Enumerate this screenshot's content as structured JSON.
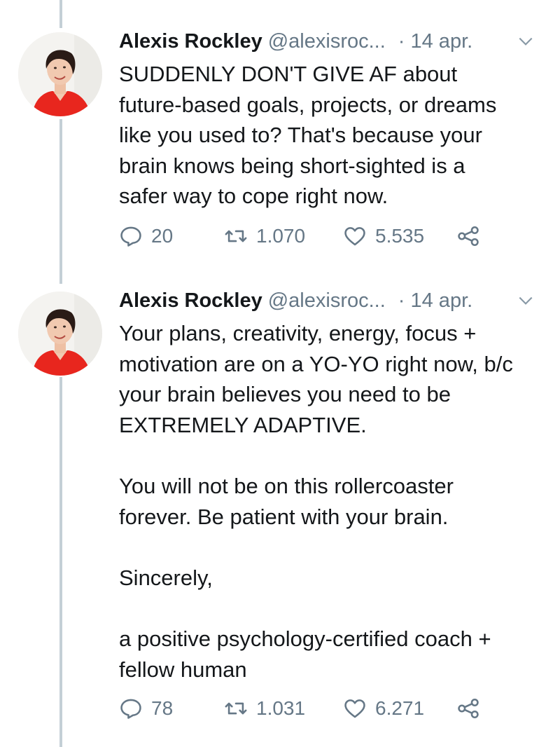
{
  "tweets": [
    {
      "author_name": "Alexis Rockley",
      "handle": "@alexisroc...",
      "date": "· 14 apr.",
      "text": "SUDDENLY DON'T GIVE AF about\nfuture-based goals, projects, or dreams\nlike you used to? That's because your\nbrain knows being short-sighted is a\nsafer way to cope right now.",
      "replies": "20",
      "retweets": "1.070",
      "likes": "5.535"
    },
    {
      "author_name": "Alexis Rockley",
      "handle": "@alexisroc...",
      "date": "· 14 apr.",
      "text": "Your plans, creativity, energy, focus +\nmotivation are on a YO-YO right now, b/c\nyour brain believes you need to be\nEXTREMELY ADAPTIVE.\n\nYou will not be on this rollercoaster\nforever. Be patient with your brain.\n\nSincerely,\n\na positive psychology-certified coach +\nfellow human",
      "replies": "78",
      "retweets": "1.031",
      "likes": "6.271"
    }
  ],
  "icons": {
    "reply": "reply-icon",
    "retweet": "retweet-icon",
    "like": "heart-icon",
    "share": "share-icon",
    "caret": "chevron-down-icon"
  },
  "colors": {
    "text": "#14171a",
    "secondary": "#657786",
    "thread_line": "#c4cfd6",
    "avatar_shirt": "#e8261e"
  }
}
